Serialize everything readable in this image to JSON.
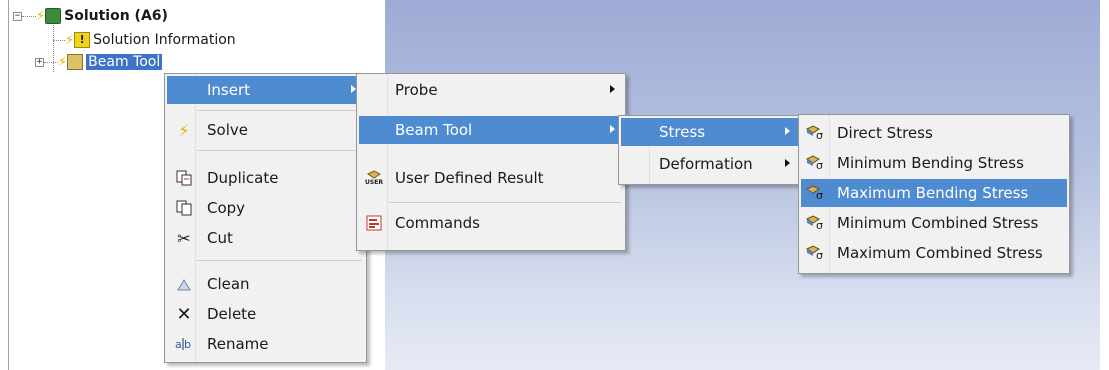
{
  "tree": {
    "items": [
      {
        "label": "Solution (A6)"
      },
      {
        "label": "Solution Information"
      },
      {
        "label": "Beam Tool"
      }
    ]
  },
  "context_menu": {
    "insert_label": "Insert",
    "solve_label": "Solve",
    "duplicate_label": "Duplicate",
    "copy_label": "Copy",
    "cut_label": "Cut",
    "clean_label": "Clean",
    "delete_label": "Delete",
    "rename_label": "Rename"
  },
  "insert_submenu": {
    "probe_label": "Probe",
    "beam_tool_label": "Beam Tool",
    "user_defined_result_label": "User Defined Result",
    "user_icon_text": "USER",
    "commands_label": "Commands"
  },
  "beam_tool_submenu": {
    "stress_label": "Stress",
    "deformation_label": "Deformation"
  },
  "stress_submenu": {
    "items": [
      {
        "label": "Direct Stress"
      },
      {
        "label": "Minimum Bending Stress"
      },
      {
        "label": "Maximum Bending Stress"
      },
      {
        "label": "Minimum Combined Stress"
      },
      {
        "label": "Maximum Combined Stress"
      }
    ],
    "highlighted_index": 2,
    "sigma_symbol": "σ"
  },
  "colors": {
    "menu_highlight": "#4f8bd1",
    "tree_selection": "#3f73c7",
    "viewport_top": "#9eacd5",
    "menu_background": "#f1f1f1"
  }
}
